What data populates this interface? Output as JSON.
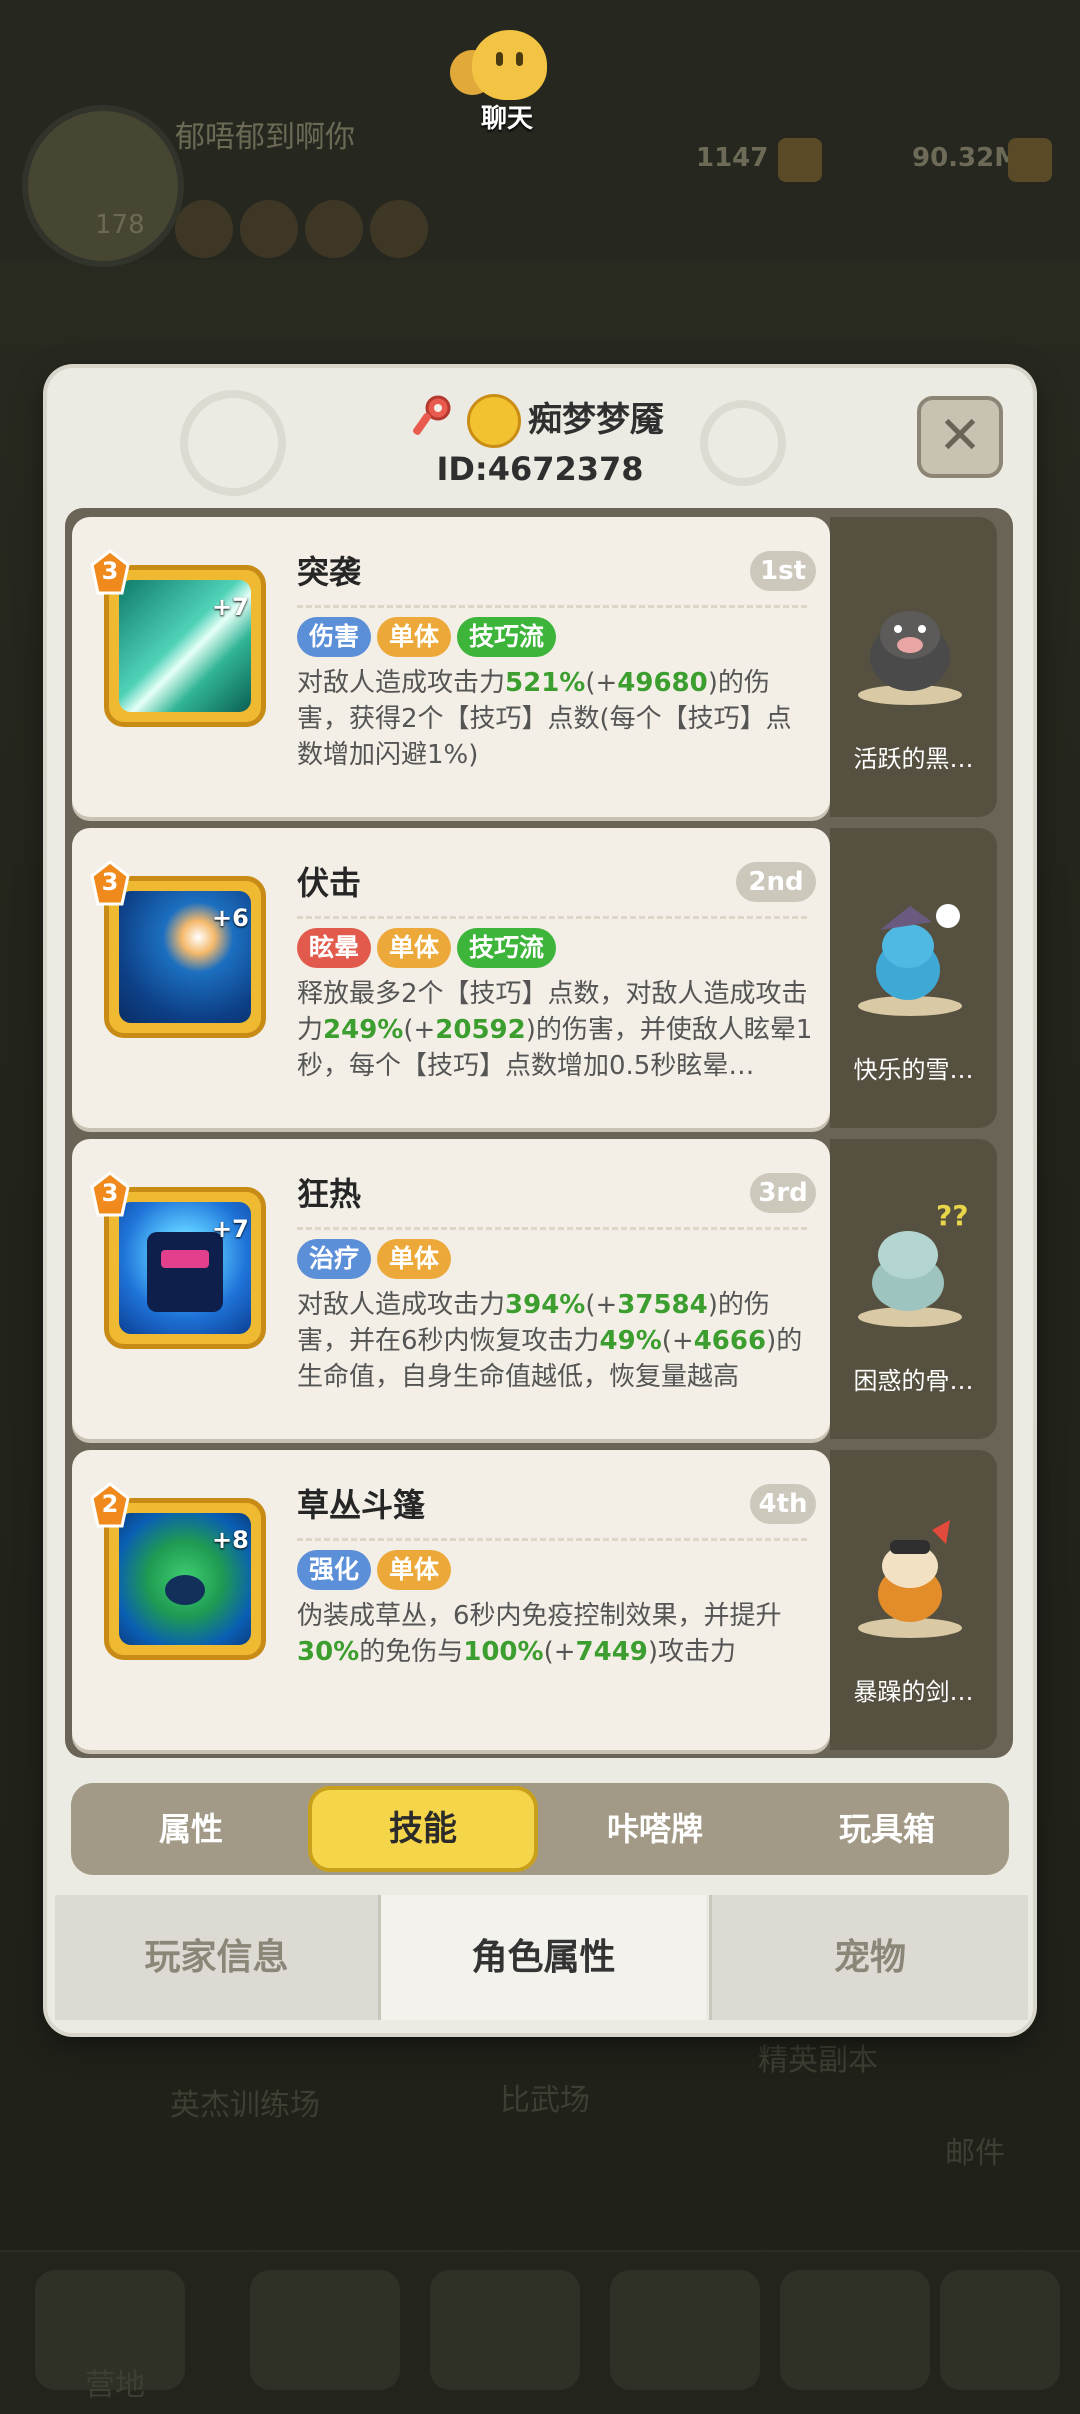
{
  "chat": {
    "label": "聊天"
  },
  "background": {
    "player_name": "郁唔郁到啊你",
    "level": "178",
    "currency1": "1147",
    "currency2": "90.32M",
    "labels": [
      "英杰训练场",
      "比武场",
      "精英副本",
      "邮件"
    ],
    "nav_first": "营地"
  },
  "modal": {
    "name": "痴梦梦魇",
    "id": "ID:4672378",
    "close": "✕"
  },
  "skills": [
    {
      "name": "突袭",
      "rank": "1st",
      "level": "3",
      "plus": "+7",
      "tags": [
        "伤害",
        "单体",
        "技巧流"
      ],
      "desc": [
        "对敌人造成攻击力",
        "521%",
        "(+",
        "49680",
        ")的伤害，获得2个【技巧】点数(每个【技巧】点数增加闪避1%)"
      ],
      "pet": "活跃的黑…"
    },
    {
      "name": "伏击",
      "rank": "2nd",
      "level": "3",
      "plus": "+6",
      "tags": [
        "眩晕",
        "单体",
        "技巧流"
      ],
      "desc": [
        "释放最多2个【技巧】点数，对敌人造成攻击力",
        "249%",
        "(+",
        "20592",
        ")的伤害，并使敌人眩晕1秒，每个【技巧】点数增加0.5秒眩晕…"
      ],
      "pet": "快乐的雪…"
    },
    {
      "name": "狂热",
      "rank": "3rd",
      "level": "3",
      "plus": "+7",
      "tags": [
        "治疗",
        "单体"
      ],
      "desc": [
        "对敌人造成攻击力",
        "394%",
        "(+",
        "37584",
        ")的伤害，并在6秒内恢复攻击力",
        "49%",
        "(+",
        "4666",
        ")的生命值，自身生命值越低，恢复量越高"
      ],
      "pet": "困惑的骨…"
    },
    {
      "name": "草丛斗篷",
      "rank": "4th",
      "level": "2",
      "plus": "+8",
      "tags": [
        "强化",
        "单体"
      ],
      "desc": [
        "伪装成草丛，6秒内免疫控制效果，并提升",
        "30%",
        "的免伤与",
        "100%",
        "(+",
        "7449",
        ")攻击力"
      ],
      "pet": "暴躁的剑…"
    }
  ],
  "subtabs": [
    "属性",
    "技能",
    "咔嗒牌",
    "玩具箱"
  ],
  "maintabs": [
    "玩家信息",
    "角色属性",
    "宠物"
  ],
  "colors": {
    "tag_blue": "#5b8fd8",
    "tag_orange": "#eca93a",
    "tag_green": "#3db43a",
    "tag_red": "#e25a4b",
    "accent": "#f5d64a"
  }
}
